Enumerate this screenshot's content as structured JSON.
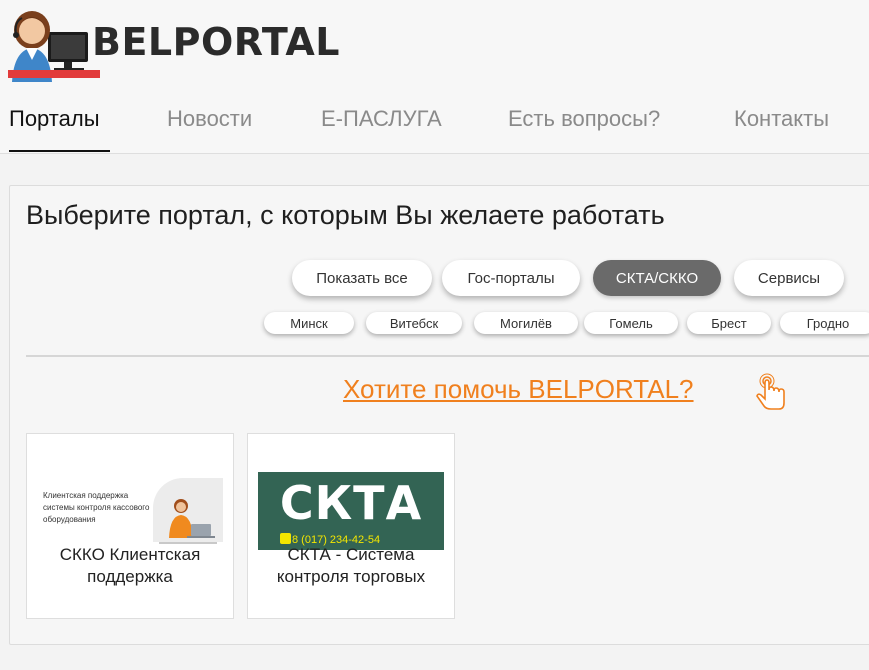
{
  "header": {
    "logo_text": "BELPORTAL"
  },
  "nav": {
    "items": [
      {
        "label": "Порталы",
        "active": true
      },
      {
        "label": "Новости",
        "active": false
      },
      {
        "label": "Е-ПАСЛУГА",
        "active": false
      },
      {
        "label": "Есть вопросы?",
        "active": false
      },
      {
        "label": "Контакты",
        "active": false
      }
    ]
  },
  "main": {
    "title": "Выберите портал, с которым Вы желаете работать",
    "filters": [
      {
        "label": "Показать все",
        "active": false
      },
      {
        "label": "Гос-порталы",
        "active": false
      },
      {
        "label": "СКТА/СККО",
        "active": true
      },
      {
        "label": "Сервисы",
        "active": false
      }
    ],
    "cities": [
      "Минск",
      "Витебск",
      "Могилёв",
      "Гомель",
      "Брест",
      "Гродно"
    ],
    "help_link": "Хотите помочь BELPORTAL?",
    "cards": [
      {
        "title": "СККО Клиентская поддержка",
        "image_text": "Клиентская поддержка системы контроля кассового оборудования"
      },
      {
        "title": "СКТА - Система контроля торговых",
        "image_big": "СКТА",
        "image_phone": "8 (017) 234-42-54"
      }
    ]
  },
  "colors": {
    "accent_orange": "#f0801e",
    "active_pill": "#6a6a6a",
    "ckta_green": "#336454"
  }
}
